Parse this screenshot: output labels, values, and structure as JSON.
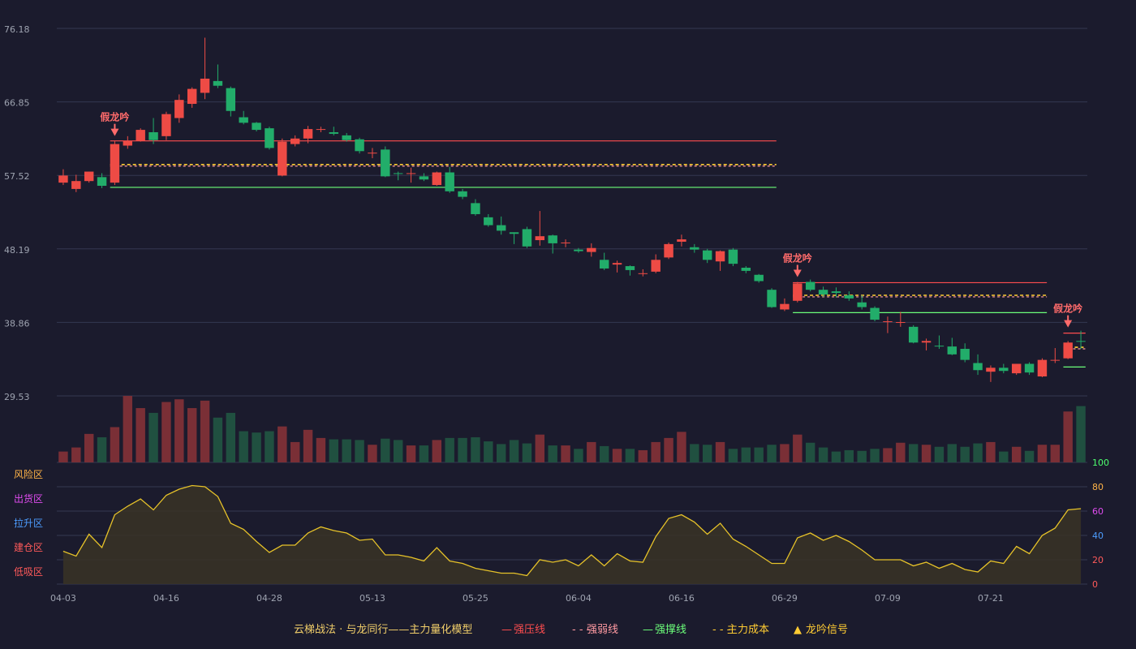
{
  "chart_data": {
    "type": "candlestick",
    "title": "",
    "price_axis": {
      "ticks": [
        76.18,
        66.85,
        57.52,
        48.19,
        38.86,
        29.53
      ]
    },
    "x_ticks": [
      "04-03",
      "04-16",
      "04-28",
      "05-13",
      "05-25",
      "06-04",
      "06-16",
      "06-29",
      "07-09",
      "07-21"
    ],
    "x_tick_index": [
      0,
      8,
      16,
      24,
      32,
      40,
      48,
      56,
      64,
      72
    ],
    "candles": [
      [
        56.6,
        57.5,
        56.3,
        58.3
      ],
      [
        55.8,
        56.8,
        55.4,
        57.6
      ],
      [
        56.8,
        58.0,
        56.6,
        58.0
      ],
      [
        57.3,
        56.2,
        55.9,
        57.8
      ],
      [
        56.6,
        61.5,
        56.3,
        61.9
      ],
      [
        61.3,
        61.9,
        60.9,
        62.5
      ],
      [
        61.9,
        63.3,
        61.8,
        63.5
      ],
      [
        63.0,
        62.0,
        61.5,
        64.8
      ],
      [
        62.5,
        65.3,
        62.0,
        65.6
      ],
      [
        64.8,
        67.1,
        64.2,
        67.8
      ],
      [
        66.6,
        68.5,
        66.1,
        68.7
      ],
      [
        68.0,
        69.8,
        67.2,
        75.0
      ],
      [
        69.5,
        68.9,
        68.6,
        71.6
      ],
      [
        68.6,
        65.7,
        65.0,
        68.8
      ],
      [
        64.9,
        64.2,
        64.0,
        65.7
      ],
      [
        64.2,
        63.3,
        63.1,
        64.3
      ],
      [
        63.5,
        61.0,
        60.8,
        63.7
      ],
      [
        57.5,
        61.8,
        57.4,
        62.2
      ],
      [
        61.5,
        62.2,
        61.2,
        62.6
      ],
      [
        62.2,
        63.4,
        61.6,
        63.8
      ],
      [
        63.3,
        63.4,
        63.0,
        63.7
      ],
      [
        63.0,
        62.8,
        62.6,
        63.7
      ],
      [
        62.6,
        62.0,
        61.8,
        62.9
      ],
      [
        62.1,
        60.6,
        60.3,
        62.3
      ],
      [
        60.4,
        60.4,
        59.7,
        61.0
      ],
      [
        60.8,
        57.4,
        57.3,
        61.2
      ],
      [
        57.8,
        57.7,
        56.9,
        58.0
      ],
      [
        57.7,
        57.8,
        56.6,
        58.5
      ],
      [
        57.4,
        57.0,
        56.8,
        57.8
      ],
      [
        56.3,
        57.9,
        56.2,
        58.0
      ],
      [
        57.9,
        55.5,
        55.3,
        58.6
      ],
      [
        55.5,
        54.8,
        54.5,
        55.8
      ],
      [
        54.0,
        52.6,
        52.4,
        54.5
      ],
      [
        52.2,
        51.2,
        51.0,
        52.6
      ],
      [
        51.2,
        50.5,
        50.0,
        52.3
      ],
      [
        50.3,
        50.1,
        48.8,
        50.3
      ],
      [
        50.7,
        48.5,
        48.3,
        51.0
      ],
      [
        49.3,
        49.8,
        48.6,
        53.0
      ],
      [
        49.9,
        48.9,
        47.6,
        50.0
      ],
      [
        49.0,
        49.0,
        48.4,
        49.4
      ],
      [
        48.1,
        47.9,
        47.7,
        48.3
      ],
      [
        47.8,
        48.3,
        47.2,
        48.9
      ],
      [
        46.8,
        45.7,
        45.5,
        47.7
      ],
      [
        46.2,
        46.4,
        45.2,
        46.7
      ],
      [
        46.0,
        45.5,
        44.8,
        46.1
      ],
      [
        45.0,
        45.1,
        44.7,
        45.6
      ],
      [
        45.3,
        46.8,
        45.1,
        47.5
      ],
      [
        47.1,
        48.8,
        46.9,
        49.0
      ],
      [
        49.1,
        49.4,
        48.5,
        50.0
      ],
      [
        48.4,
        48.1,
        47.7,
        48.8
      ],
      [
        48.0,
        46.8,
        46.4,
        48.2
      ],
      [
        46.6,
        47.9,
        45.4,
        48.0
      ],
      [
        48.1,
        46.3,
        46.0,
        48.3
      ],
      [
        45.8,
        45.4,
        45.1,
        46.0
      ],
      [
        44.9,
        44.1,
        43.9,
        45.0
      ],
      [
        43.0,
        40.8,
        40.7,
        43.2
      ],
      [
        40.5,
        41.2,
        40.3,
        41.9
      ],
      [
        41.6,
        43.8,
        41.4,
        44.0
      ],
      [
        44.0,
        43.0,
        42.8,
        44.3
      ],
      [
        43.0,
        42.4,
        42.1,
        43.4
      ],
      [
        42.8,
        42.6,
        42.0,
        43.3
      ],
      [
        42.3,
        41.9,
        41.6,
        42.8
      ],
      [
        41.4,
        40.8,
        40.5,
        42.3
      ],
      [
        40.7,
        39.2,
        39.0,
        40.9
      ],
      [
        39.0,
        39.0,
        37.5,
        39.6
      ],
      [
        38.9,
        38.9,
        38.3,
        40.2
      ],
      [
        38.3,
        36.3,
        36.2,
        38.5
      ],
      [
        36.3,
        36.5,
        35.3,
        36.8
      ],
      [
        35.9,
        35.8,
        35.5,
        37.2
      ],
      [
        35.8,
        34.8,
        34.7,
        36.9
      ],
      [
        35.5,
        34.1,
        33.8,
        36.2
      ],
      [
        33.7,
        32.8,
        32.2,
        34.8
      ],
      [
        32.6,
        33.1,
        31.3,
        33.4
      ],
      [
        33.1,
        32.7,
        32.4,
        33.6
      ],
      [
        32.4,
        33.6,
        32.2,
        33.6
      ],
      [
        33.6,
        32.5,
        32.2,
        33.8
      ],
      [
        32.0,
        34.1,
        31.9,
        34.3
      ],
      [
        34.0,
        34.1,
        33.7,
        35.6
      ],
      [
        34.3,
        36.3,
        34.2,
        36.5
      ],
      [
        36.5,
        36.4,
        35.5,
        37.8
      ]
    ],
    "volumes": [
      1.6,
      2.2,
      4.2,
      3.7,
      5.2,
      9.8,
      8.0,
      7.3,
      8.9,
      9.3,
      8.0,
      9.1,
      6.6,
      7.3,
      4.6,
      4.4,
      4.6,
      5.3,
      3.0,
      4.8,
      3.6,
      3.4,
      3.4,
      3.3,
      2.6,
      3.5,
      3.3,
      2.5,
      2.5,
      3.3,
      3.6,
      3.6,
      3.7,
      3.1,
      2.7,
      3.3,
      2.8,
      4.1,
      2.5,
      2.5,
      2.0,
      3.0,
      2.4,
      2.0,
      2.0,
      1.8,
      3.0,
      3.6,
      4.5,
      2.7,
      2.6,
      3.0,
      2.0,
      2.2,
      2.2,
      2.6,
      2.7,
      4.1,
      2.9,
      2.2,
      1.6,
      1.8,
      1.7,
      2.0,
      2.1,
      2.9,
      2.7,
      2.6,
      2.3,
      2.7,
      2.3,
      2.8,
      3.0,
      1.6,
      2.3,
      1.7,
      2.6,
      2.6,
      7.5,
      8.3
    ],
    "oscillator": {
      "levels": [
        0,
        20,
        40,
        60,
        80,
        100
      ],
      "zones": [
        "低吸区",
        "建仓区",
        "拉升区",
        "出货区",
        "风险区"
      ],
      "values": [
        27,
        23,
        41,
        30,
        57,
        64,
        70,
        61,
        73,
        78,
        81,
        80,
        72,
        50,
        45,
        35,
        26,
        32,
        32,
        42,
        47,
        44,
        42,
        36,
        37,
        24,
        24,
        22,
        19,
        30,
        19,
        17,
        13,
        11,
        9,
        9,
        7,
        20,
        18,
        20,
        15,
        24,
        15,
        25,
        19,
        18,
        39,
        54,
        57,
        51,
        41,
        50,
        37,
        31,
        24,
        17,
        17,
        38,
        42,
        36,
        40,
        35,
        28,
        20,
        20,
        20,
        15,
        18,
        13,
        17,
        12,
        10,
        19,
        17,
        31,
        25,
        40,
        46,
        61,
        62
      ]
    },
    "overlays": {
      "segments": [
        {
          "from": 4,
          "to": 55,
          "strong_resist": 61.9,
          "weak_resist": 58.7,
          "support": 56.0,
          "main_cost": 58.9
        },
        {
          "from": 57,
          "to": 76,
          "strong_resist": 43.9,
          "weak_resist": 42.1,
          "support": 40.1,
          "main_cost": 42.3
        },
        {
          "from": 78,
          "to": 79,
          "strong_resist": 37.5,
          "weak_resist": 35.5,
          "support": 33.2,
          "main_cost": 35.7
        }
      ],
      "signals": [
        {
          "index": 4,
          "price": 61.9,
          "label": "假龙吟"
        },
        {
          "index": 57,
          "price": 44.0,
          "label": "假龙吟"
        },
        {
          "index": 78,
          "price": 37.6,
          "label": "假龙吟"
        }
      ]
    },
    "legend": {
      "model": "云梯战法 · 与龙同行——主力量化模型",
      "items": [
        {
          "name": "强压线",
          "color": "#ff4d4f",
          "style": "solid",
          "glyph": "—"
        },
        {
          "name": "强弱线",
          "color": "#ff9aa2",
          "style": "dashed",
          "glyph": "- - -"
        },
        {
          "name": "强撑线",
          "color": "#6cff7a",
          "style": "solid",
          "glyph": "—"
        },
        {
          "name": "主力成本",
          "color": "#ffcc33",
          "style": "dashed",
          "glyph": "- - -"
        },
        {
          "name": "龙吟信号",
          "color": "#ffcc33",
          "style": "marker",
          "glyph": "▲"
        }
      ]
    },
    "colors": {
      "up": "#ee4b45",
      "down": "#22ad6a",
      "vol_up": "#7a2f36",
      "vol_down": "#205040",
      "grid": "#343851",
      "osc_line": "#e6c229",
      "osc_fill": "#383326"
    },
    "zone_colors": [
      "#ff5a5a",
      "#ff5a5a",
      "#4d9dff",
      "#e04cf0",
      "#ffb347"
    ],
    "osc_level_colors": [
      "#ff5a5a",
      "#ff5a5a",
      "#4d9dff",
      "#e04cf0",
      "#ffb347",
      "#4dff6e"
    ]
  }
}
